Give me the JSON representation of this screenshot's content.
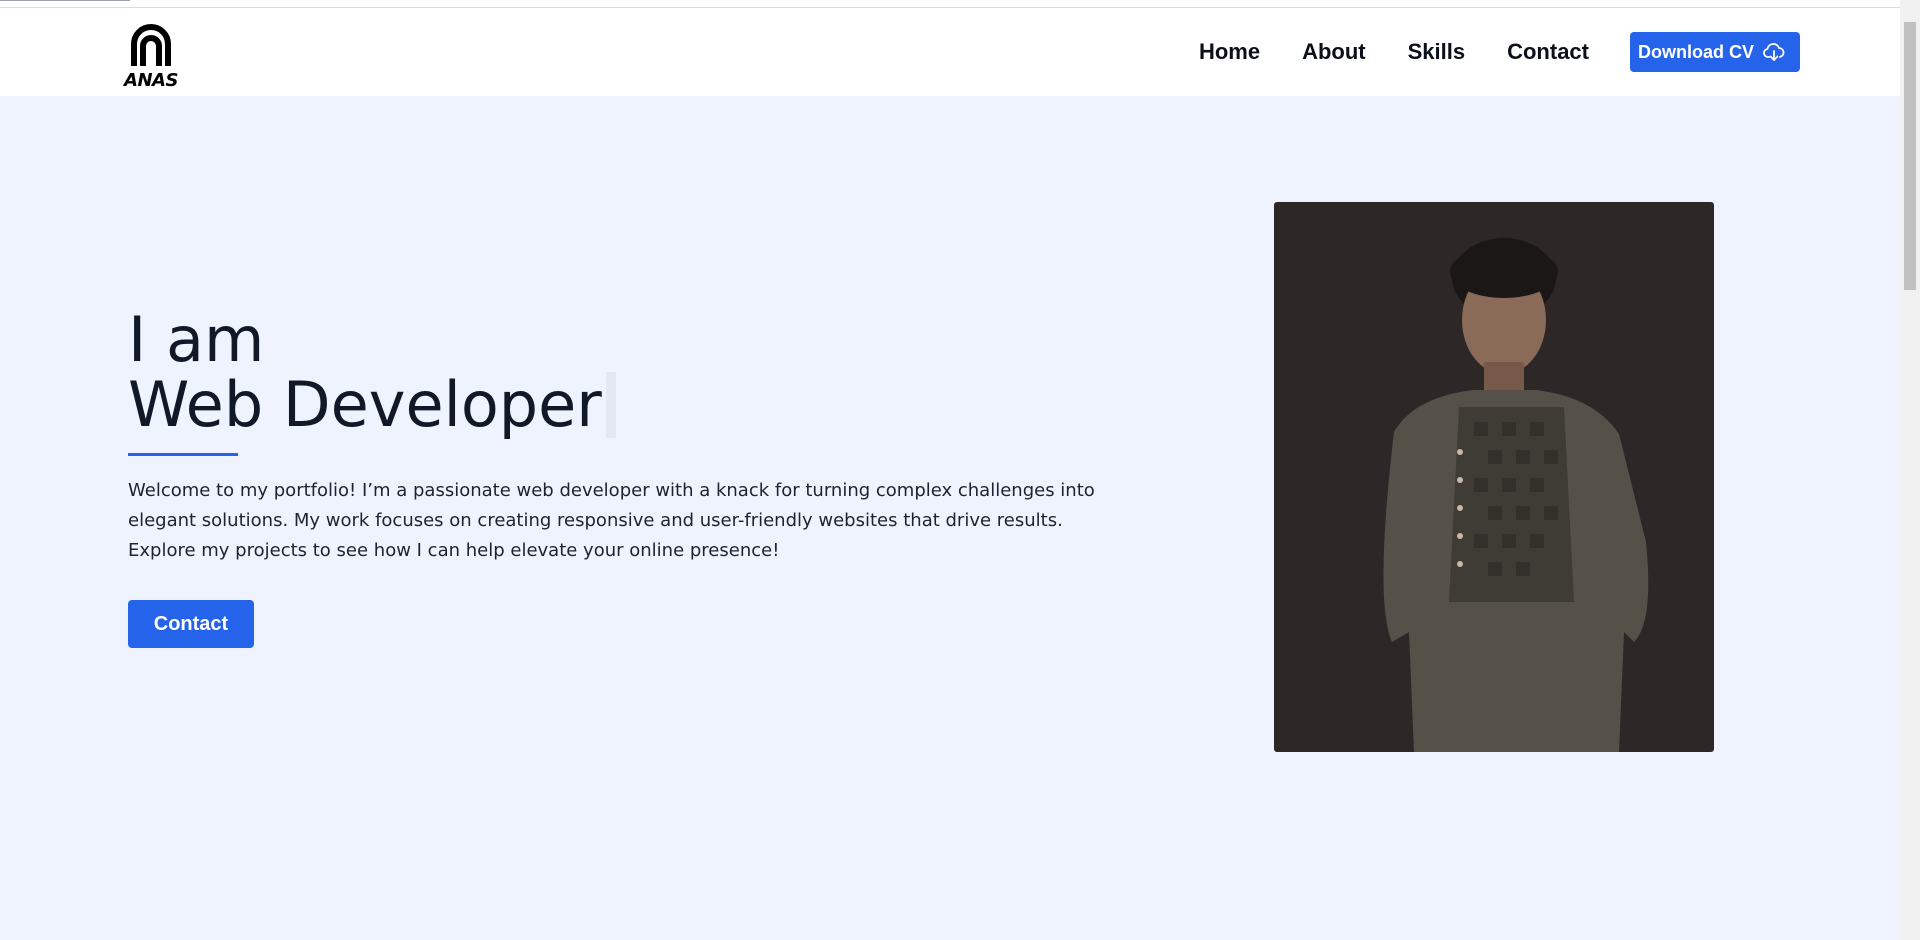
{
  "header": {
    "logo_text": "ANAS",
    "nav": [
      {
        "label": "Home"
      },
      {
        "label": "About"
      },
      {
        "label": "Skills"
      },
      {
        "label": "Contact"
      }
    ],
    "cv_button": {
      "label": "Download CV",
      "icon": "cloud-download-icon"
    }
  },
  "hero": {
    "title_line1": "I am",
    "title_line2": "Web Developer",
    "intro": "Welcome to my portfolio! I’m a passionate web developer with a knack for turning complex challenges into elegant solutions. My work focuses on creating responsive and user-friendly websites that drive results. Explore my projects to see how I can help elevate your online presence!",
    "contact_button": "Contact"
  },
  "colors": {
    "accent": "#2563eb",
    "background": "#eff3fe",
    "header": "#ffffff",
    "text": "#111827",
    "photo_bg": "#2e2727"
  }
}
